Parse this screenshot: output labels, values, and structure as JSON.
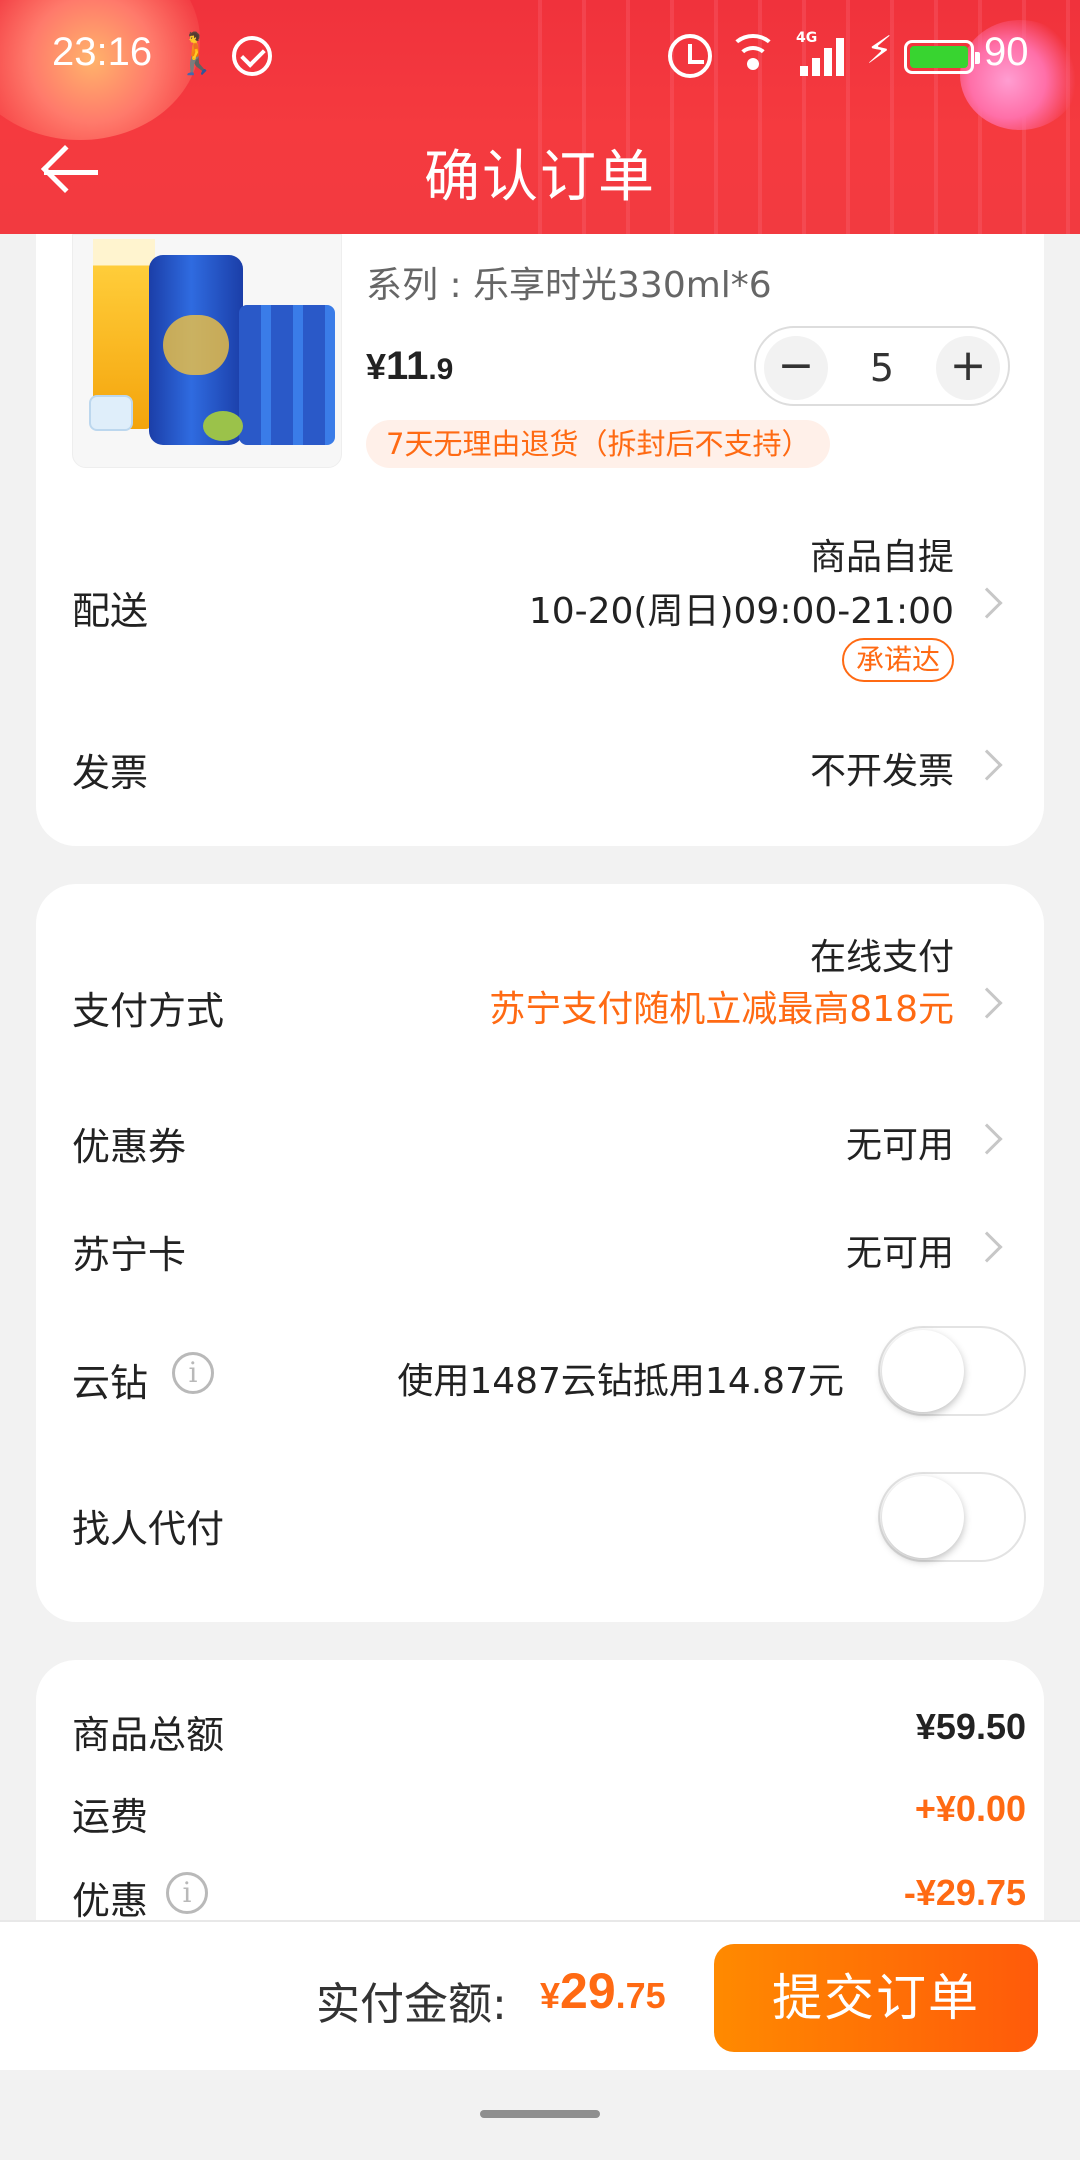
{
  "status_bar": {
    "time": "23:16",
    "network": "4G",
    "battery": "90",
    "battery_color": "#38d430"
  },
  "nav": {
    "title": "确认订单"
  },
  "product": {
    "spec": "系列 : 乐享时光330ml*6",
    "price_currency": "¥",
    "price_integer": "11",
    "price_decimal": ".9",
    "quantity": "5",
    "minus_label": "−",
    "plus_label": "+",
    "refund_tag": "7天无理由退货（拆封后不支持）"
  },
  "delivery": {
    "label": "配送",
    "method": "商品自提",
    "time": "10-20(周日)09:00-21:00",
    "badge": "承诺达"
  },
  "invoice": {
    "label": "发票",
    "value": "不开发票"
  },
  "payment": {
    "label": "支付方式",
    "value": "在线支付",
    "promo": "苏宁支付随机立减最高818元"
  },
  "coupon": {
    "label": "优惠券",
    "value": "无可用"
  },
  "suning_card": {
    "label": "苏宁卡",
    "value": "无可用"
  },
  "yunzuan": {
    "label": "云钻",
    "info_icon": "i",
    "desc": "使用1487云钻抵用14.87元",
    "enabled": false
  },
  "proxy_pay": {
    "label": "找人代付",
    "enabled": false
  },
  "summary": {
    "goods_label": "商品总额",
    "goods_value": "¥59.50",
    "shipping_label": "运费",
    "shipping_value": "+¥0.00",
    "discount_label": "优惠",
    "discount_value": "-¥29.75"
  },
  "bottom_bar": {
    "pay_label": "实付金额:",
    "pay_currency": "¥",
    "pay_integer": "29",
    "pay_decimal": ".75",
    "submit_label": "提交订单"
  },
  "colors": {
    "brand_red": "#f0323c",
    "accent_orange": "#ff6a13"
  }
}
